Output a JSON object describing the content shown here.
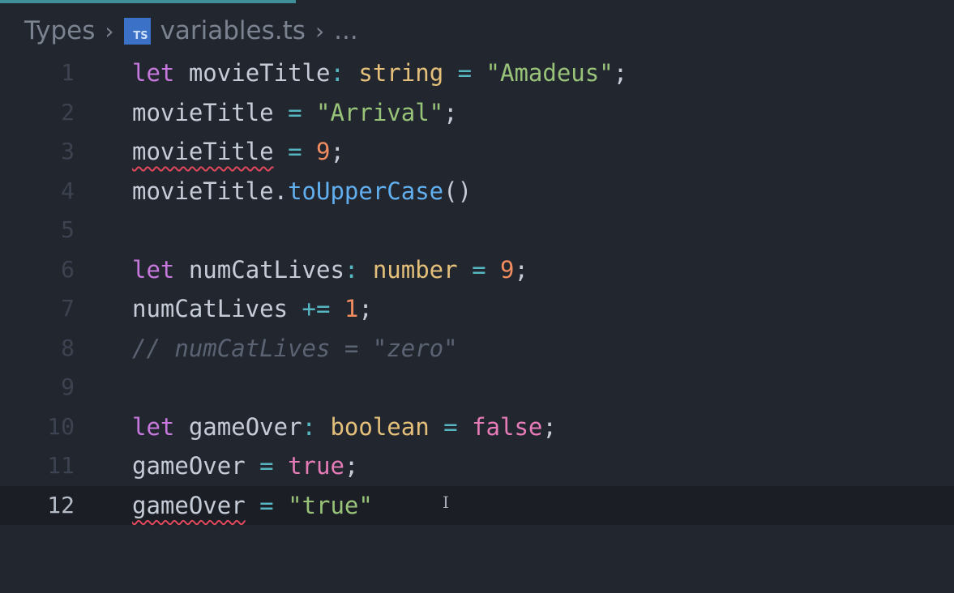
{
  "breadcrumb": {
    "folder": "Types",
    "file_icon": "TS",
    "file": "variables.ts",
    "more": "..."
  },
  "colors": {
    "keyword": "#c678dd",
    "type": "#e5c07b",
    "operator": "#56b6c2",
    "string": "#98c379",
    "number": "#f08c5f",
    "boolean": "#e57bb7",
    "function": "#61afef",
    "comment": "#5b6373",
    "error_squiggle": "#e0485c",
    "accent": "#3f8f9a"
  },
  "lines": [
    {
      "number": "1",
      "tokens": [
        {
          "t": "let",
          "k": "kw"
        },
        {
          "t": " movieTitle",
          "k": "pun"
        },
        {
          "t": ":",
          "k": "op"
        },
        {
          "t": " ",
          "k": "pun"
        },
        {
          "t": "string",
          "k": "type"
        },
        {
          "t": " = ",
          "k": "op"
        },
        {
          "t": "\"Amadeus\"",
          "k": "str"
        },
        {
          "t": ";",
          "k": "pun"
        }
      ]
    },
    {
      "number": "2",
      "tokens": [
        {
          "t": "movieTitle",
          "k": "pun"
        },
        {
          "t": " = ",
          "k": "op"
        },
        {
          "t": "\"Arrival\"",
          "k": "str"
        },
        {
          "t": ";",
          "k": "pun"
        }
      ]
    },
    {
      "number": "3",
      "tokens": [
        {
          "t": "movieTitle",
          "k": "pun",
          "err": true
        },
        {
          "t": " = ",
          "k": "op"
        },
        {
          "t": "9",
          "k": "num"
        },
        {
          "t": ";",
          "k": "pun"
        }
      ]
    },
    {
      "number": "4",
      "tokens": [
        {
          "t": "movieTitle",
          "k": "pun"
        },
        {
          "t": ".",
          "k": "pun"
        },
        {
          "t": "toUpperCase",
          "k": "fn"
        },
        {
          "t": "()",
          "k": "pun"
        }
      ]
    },
    {
      "number": "5",
      "tokens": []
    },
    {
      "number": "6",
      "tokens": [
        {
          "t": "let",
          "k": "kw"
        },
        {
          "t": " numCatLives",
          "k": "pun"
        },
        {
          "t": ":",
          "k": "op"
        },
        {
          "t": " ",
          "k": "pun"
        },
        {
          "t": "number",
          "k": "type"
        },
        {
          "t": " = ",
          "k": "op"
        },
        {
          "t": "9",
          "k": "num"
        },
        {
          "t": ";",
          "k": "pun"
        }
      ]
    },
    {
      "number": "7",
      "tokens": [
        {
          "t": "numCatLives",
          "k": "pun"
        },
        {
          "t": " += ",
          "k": "op"
        },
        {
          "t": "1",
          "k": "num"
        },
        {
          "t": ";",
          "k": "pun"
        }
      ]
    },
    {
      "number": "8",
      "tokens": [
        {
          "t": "// numCatLives = \"zero\"",
          "k": "cmt"
        }
      ]
    },
    {
      "number": "9",
      "tokens": []
    },
    {
      "number": "10",
      "tokens": [
        {
          "t": "let",
          "k": "kw"
        },
        {
          "t": " gameOver",
          "k": "pun"
        },
        {
          "t": ":",
          "k": "op"
        },
        {
          "t": " ",
          "k": "pun"
        },
        {
          "t": "boolean",
          "k": "type"
        },
        {
          "t": " = ",
          "k": "op"
        },
        {
          "t": "false",
          "k": "bool"
        },
        {
          "t": ";",
          "k": "pun"
        }
      ]
    },
    {
      "number": "11",
      "tokens": [
        {
          "t": "gameOver",
          "k": "pun"
        },
        {
          "t": " = ",
          "k": "op"
        },
        {
          "t": "true",
          "k": "bool"
        },
        {
          "t": ";",
          "k": "pun"
        }
      ]
    },
    {
      "number": "12",
      "current": true,
      "tokens": [
        {
          "t": "gameOver",
          "k": "pun",
          "err": true
        },
        {
          "t": " = ",
          "k": "op"
        },
        {
          "t": "\"true\"",
          "k": "str"
        }
      ]
    }
  ]
}
